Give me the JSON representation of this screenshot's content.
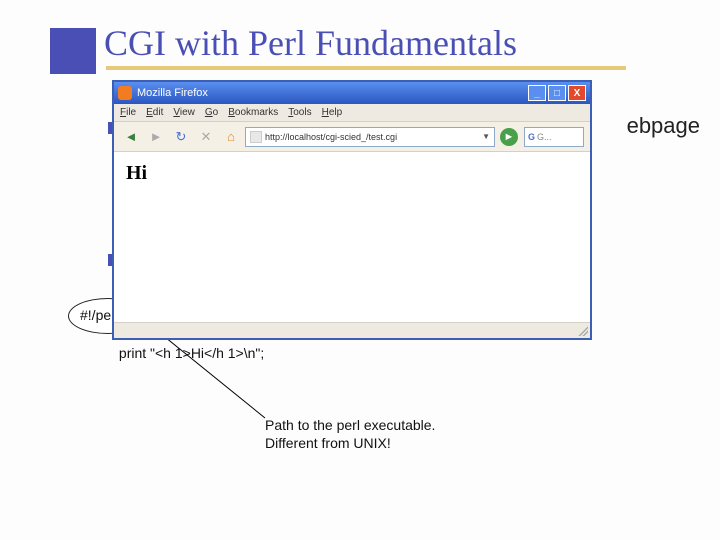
{
  "slide": {
    "title": "CGI with Perl Fundamentals",
    "trailing_text": "ebpage",
    "code_line1": "#!/pe",
    "code_line2": "print \"<h 1>Hi</h 1>\\n\";",
    "annotation_line1": "Path to the perl executable.",
    "annotation_line2": "Different from UNIX!"
  },
  "browser": {
    "title": "Mozilla Firefox",
    "menus": {
      "file": "File",
      "edit": "Edit",
      "view": "View",
      "go": "Go",
      "bookmarks": "Bookmarks",
      "tools": "Tools",
      "help": "Help"
    },
    "address_url": "http://localhost/cgi-scied_/test.cgi",
    "search_placeholder": "G...",
    "page_heading": "Hi"
  },
  "icons": {
    "back": "◄",
    "forward": "►",
    "reload": "↻",
    "stop": "✕",
    "home": "⌂",
    "go": "►",
    "minimize": "_",
    "maximize": "□",
    "close": "X",
    "dropdown": "▼"
  }
}
